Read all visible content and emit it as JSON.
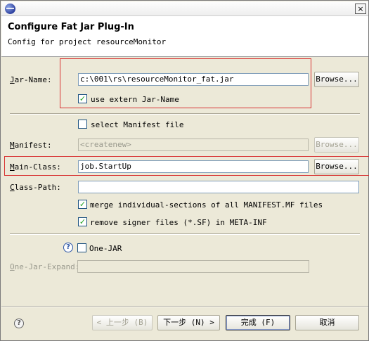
{
  "window": {
    "close_glyph": "×",
    "header_title": "Configure Fat Jar Plug-In",
    "header_subtitle": "Config for project resourceMonitor"
  },
  "form": {
    "jar_name": {
      "mnemonic": "J",
      "label_rest": "ar-Name:",
      "value": "c:\\001\\rs\\resourceMonitor_fat.jar",
      "browse": "Browse..."
    },
    "use_extern": {
      "label": "use extern Jar-Name",
      "checked": true
    },
    "select_manifest": {
      "label": "select Manifest file",
      "checked": false
    },
    "manifest": {
      "mnemonic": "M",
      "label_rest": "anifest:",
      "value": "<createnew>",
      "browse": "Browse..."
    },
    "main_class": {
      "mnemonic": "M",
      "label_rest": "ain-Class:",
      "value": "job.StartUp",
      "browse": "Browse..."
    },
    "class_path": {
      "mnemonic": "C",
      "label_rest": "lass-Path:",
      "value": ""
    },
    "merge_manifest": {
      "label": "merge individual-sections of all MANIFEST.MF files",
      "checked": true
    },
    "remove_signer": {
      "label": "remove signer files (*.SF) in META-INF",
      "checked": true
    },
    "one_jar": {
      "label": "One-JAR",
      "checked": false
    },
    "one_jar_expand": {
      "mnemonic": "O",
      "label_rest": "ne-Jar-Expand:",
      "value": ""
    }
  },
  "footer": {
    "back": "< 上一步 (B)",
    "next": "下一步 (N) >",
    "finish": "完成 (F)",
    "cancel": "取消"
  },
  "icons": {
    "help": "?",
    "check": "✓"
  }
}
